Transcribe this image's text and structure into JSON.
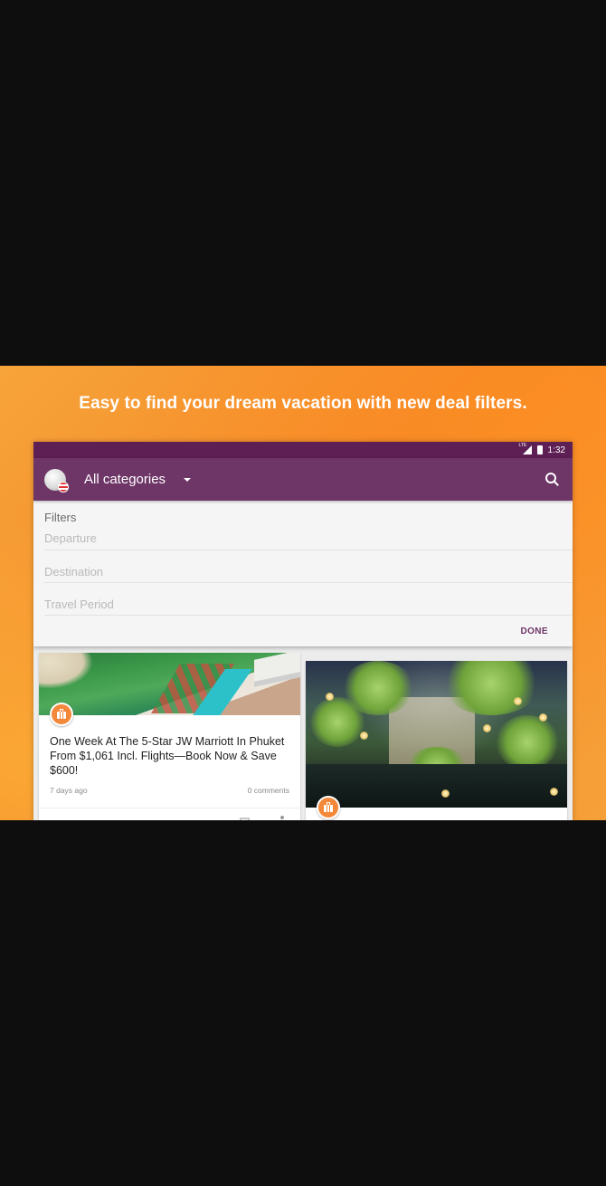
{
  "promo": {
    "tagline": "Easy to find your dream vacation with new deal filters."
  },
  "status_bar": {
    "network": "LTE",
    "time": "1:32"
  },
  "toolbar": {
    "category_label": "All categories",
    "icons": [
      "app-logo-globe",
      "dropdown-caret",
      "search-icon"
    ]
  },
  "filters": {
    "title": "Filters",
    "fields": [
      {
        "placeholder": "Departure"
      },
      {
        "placeholder": "Destination"
      },
      {
        "placeholder": "Travel Period"
      }
    ],
    "done_label": "DONE"
  },
  "deals": [
    {
      "title": "One Week At The 5-Star JW Marriott In Phuket From $1,061 Incl. Flights—Book Now & Save $600!",
      "age": "7 days ago",
      "comments": "0 comments",
      "badge_icon": "suitcase-icon"
    },
    {
      "title": "",
      "badge_icon": "suitcase-icon"
    }
  ],
  "colors": {
    "status_bar": "#5e1f55",
    "toolbar": "#6e3567",
    "accent": "#f4883a",
    "banner": "#f58a2a"
  }
}
